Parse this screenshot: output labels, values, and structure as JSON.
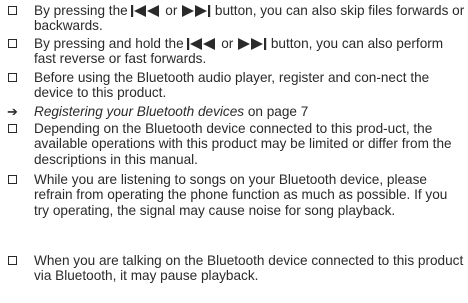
{
  "items": [
    {
      "p1": "By pressing the ",
      "p2": " or ",
      "p3": " button, you can also skip files forwards or backwards."
    },
    {
      "p1": "By pressing and hold the ",
      "p2": " or ",
      "p3": " button, you can also perform fast reverse or fast forwards."
    },
    {
      "text": "Before using the Bluetooth audio player, register and con-nect the device to this product."
    },
    {
      "ref": "Registering your Bluetooth devices",
      "suffix": " on page 7"
    },
    {
      "text": "Depending on the Bluetooth device connected to this prod-uct, the available operations with this product may be limited or differ from the descriptions in this manual."
    },
    {
      "text": "While you are listening to songs on your Bluetooth device, please refrain from operating the phone function as much as possible. If you try operating, the signal may cause noise for song playback."
    },
    {
      "text": "When you are talking on the Bluetooth device connected to this product via Bluetooth, it may pause playback."
    }
  ]
}
